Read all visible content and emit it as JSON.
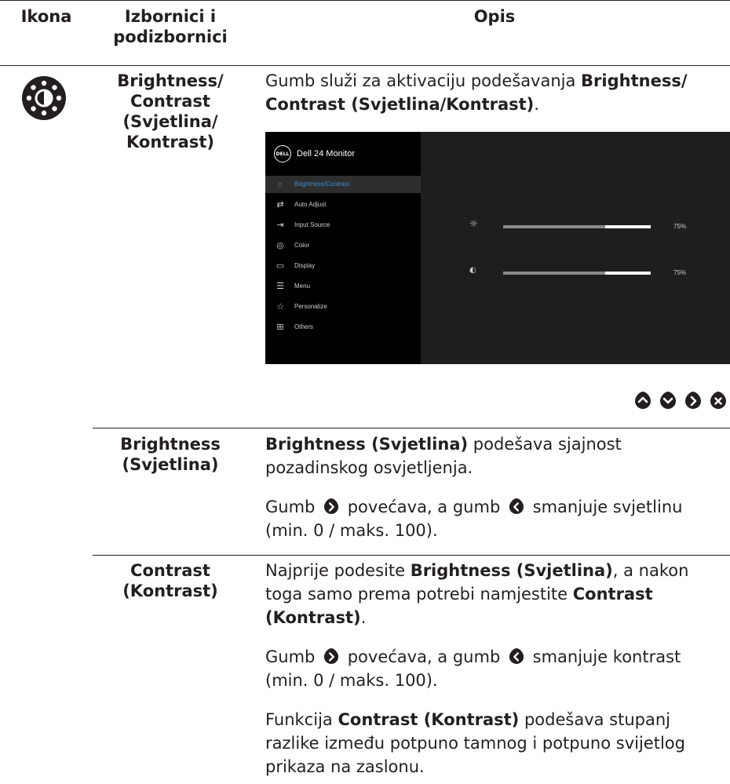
{
  "table": {
    "headers": {
      "icon": "Ikona",
      "menus": "Izbornici i podizbornici",
      "desc": "Opis"
    }
  },
  "brightness_contrast": {
    "name": "Brightness/ Contrast (Svjetlina/ Kontrast)",
    "desc_pre": "Gumb služi za aktivaciju podešavanja ",
    "desc_bold": "Brightness/ Contrast (Svjetlina/Kontrast)",
    "desc_post": "."
  },
  "osd": {
    "logo": "DELL",
    "title": "Dell 24 Monitor",
    "items": [
      {
        "label": "Brightness/Contrast",
        "icon": "brightness-icon",
        "active": true
      },
      {
        "label": "Auto Adjust",
        "icon": "auto-adjust-icon"
      },
      {
        "label": "Input Source",
        "icon": "input-source-icon"
      },
      {
        "label": "Color",
        "icon": "color-icon"
      },
      {
        "label": "Display",
        "icon": "display-icon"
      },
      {
        "label": "Menu",
        "icon": "menu-icon"
      },
      {
        "label": "Personalize",
        "icon": "personalize-icon"
      },
      {
        "label": "Others",
        "icon": "others-icon"
      }
    ],
    "brightness_value": "75%",
    "contrast_value": "75%",
    "brightness_level": 0.75,
    "contrast_level": 0.75
  },
  "nav_buttons": [
    "up-button",
    "down-button",
    "right-button",
    "close-button"
  ],
  "brightness": {
    "name": "Brightness (Svjetlina)",
    "p1_bold": "Brightness (Svjetlina)",
    "p1_rest": " podešava sjajnost pozadinskog osvjetljenja.",
    "p2_a": "Gumb ",
    "p2_b": " povećava, a gumb ",
    "p2_c": " smanjuje svjetlinu (min. 0 / maks. 100)."
  },
  "contrast": {
    "name": "Contrast (Kontrast)",
    "p1_a": "Najprije podesite ",
    "p1_bold1": "Brightness (Svjetlina)",
    "p1_b": ", a nakon toga samo prema potrebi namjestite ",
    "p1_bold2": "Contrast (Kontrast)",
    "p1_c": ".",
    "p2_a": "Gumb ",
    "p2_b": " povećava, a gumb ",
    "p2_c": " smanjuje kontrast (min. 0 / maks. 100).",
    "p3_a": "Funkcija ",
    "p3_bold": "Contrast (Kontrast)",
    "p3_b": " podešava stupanj razlike između potpuno tamnog i potpuno svijetlog prikaza na zaslonu."
  }
}
